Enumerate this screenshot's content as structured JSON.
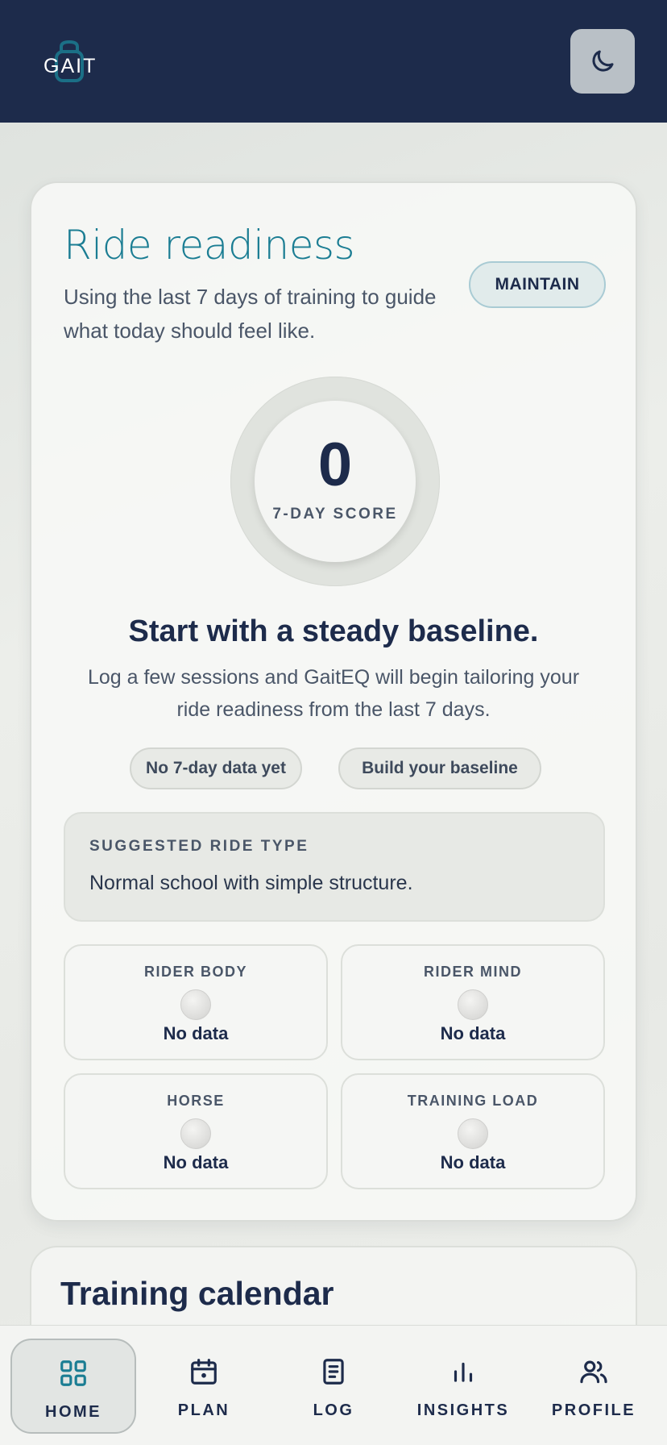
{
  "header": {
    "logo_text": "GAIT",
    "theme_toggle_icon": "moon-icon"
  },
  "readiness": {
    "title": "Ride readiness",
    "subtitle": "Using the last 7 days of training to guide what today should feel like.",
    "badge": "MAINTAIN",
    "score": "0",
    "score_label": "7-DAY SCORE",
    "headline": "Start with a steady baseline.",
    "description": "Log a few sessions and GaitEQ will begin tailoring your ride readiness from the last 7 days.",
    "chips": [
      "No 7-day data yet",
      "Build your baseline"
    ],
    "suggested": {
      "label": "SUGGESTED RIDE TYPE",
      "text": "Normal school with simple structure."
    },
    "metrics": [
      {
        "label": "RIDER BODY",
        "value": "No data"
      },
      {
        "label": "RIDER MIND",
        "value": "No data"
      },
      {
        "label": "HORSE",
        "value": "No data"
      },
      {
        "label": "TRAINING LOAD",
        "value": "No data"
      }
    ]
  },
  "calendar": {
    "title": "Training calendar"
  },
  "nav": {
    "items": [
      {
        "label": "HOME",
        "icon": "grid-icon",
        "active": true
      },
      {
        "label": "PLAN",
        "icon": "calendar-icon",
        "active": false
      },
      {
        "label": "LOG",
        "icon": "document-icon",
        "active": false
      },
      {
        "label": "INSIGHTS",
        "icon": "bar-chart-icon",
        "active": false
      },
      {
        "label": "PROFILE",
        "icon": "users-icon",
        "active": false
      }
    ]
  },
  "colors": {
    "header_bg": "#1d2b4b",
    "accent_teal": "#1b7d93",
    "text_dark": "#1d2b4b"
  }
}
